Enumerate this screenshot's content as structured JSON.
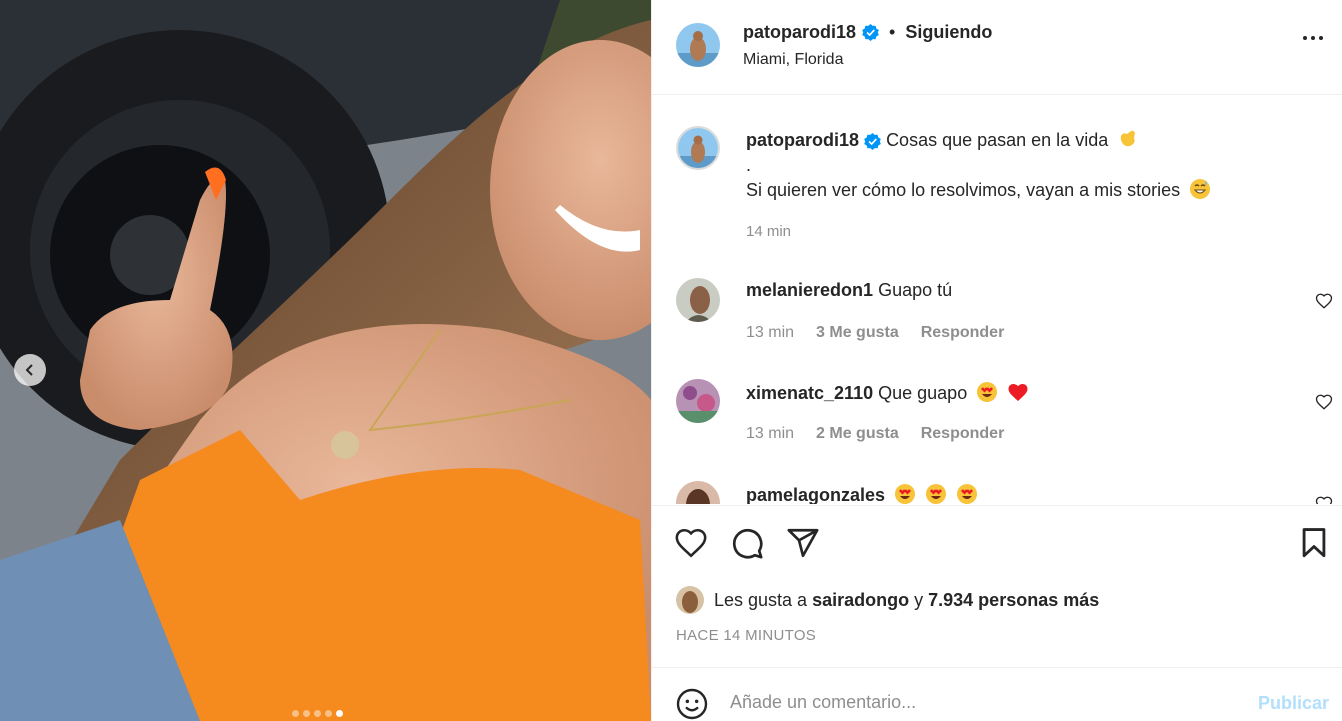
{
  "post": {
    "username": "patoparodi18",
    "separator": "•",
    "follow_status": "Siguiendo",
    "location": "Miami, Florida",
    "caption_line1": "Cosas que pasan en la vida",
    "caption_line2": ".",
    "caption_line3": "Si quieren ver cómo lo resolvimos, vayan a mis stories",
    "caption_time": "14 min",
    "carousel": {
      "total": 5,
      "active_index": 4
    }
  },
  "comments": [
    {
      "username": "melanieredon1",
      "text": "Guapo tú",
      "time": "13 min",
      "likes": "3 Me gusta",
      "reply": "Responder"
    },
    {
      "username": "ximenatc_2110",
      "text": "Que guapo",
      "time": "13 min",
      "likes": "2 Me gusta",
      "reply": "Responder"
    },
    {
      "username": "pamelagonzales",
      "text": ""
    }
  ],
  "likes": {
    "prefix": "Les gusta a",
    "user": "sairadongo",
    "middle": "y",
    "others": "7.934 personas más"
  },
  "time_ago": "HACE 14 MINUTOS",
  "comment_box": {
    "placeholder": "Añade un comentario...",
    "post_label": "Publicar"
  },
  "colors": {
    "verified": "#0095f6",
    "link_disabled": "#b2dffc",
    "secondary_text": "#8e8e8e",
    "heart": "#ed1c24"
  },
  "icons": [
    "verified-badge-icon",
    "more-options-icon",
    "heart-icon",
    "comment-icon",
    "share-icon",
    "bookmark-icon",
    "emoji-icon",
    "chevron-left-icon"
  ]
}
